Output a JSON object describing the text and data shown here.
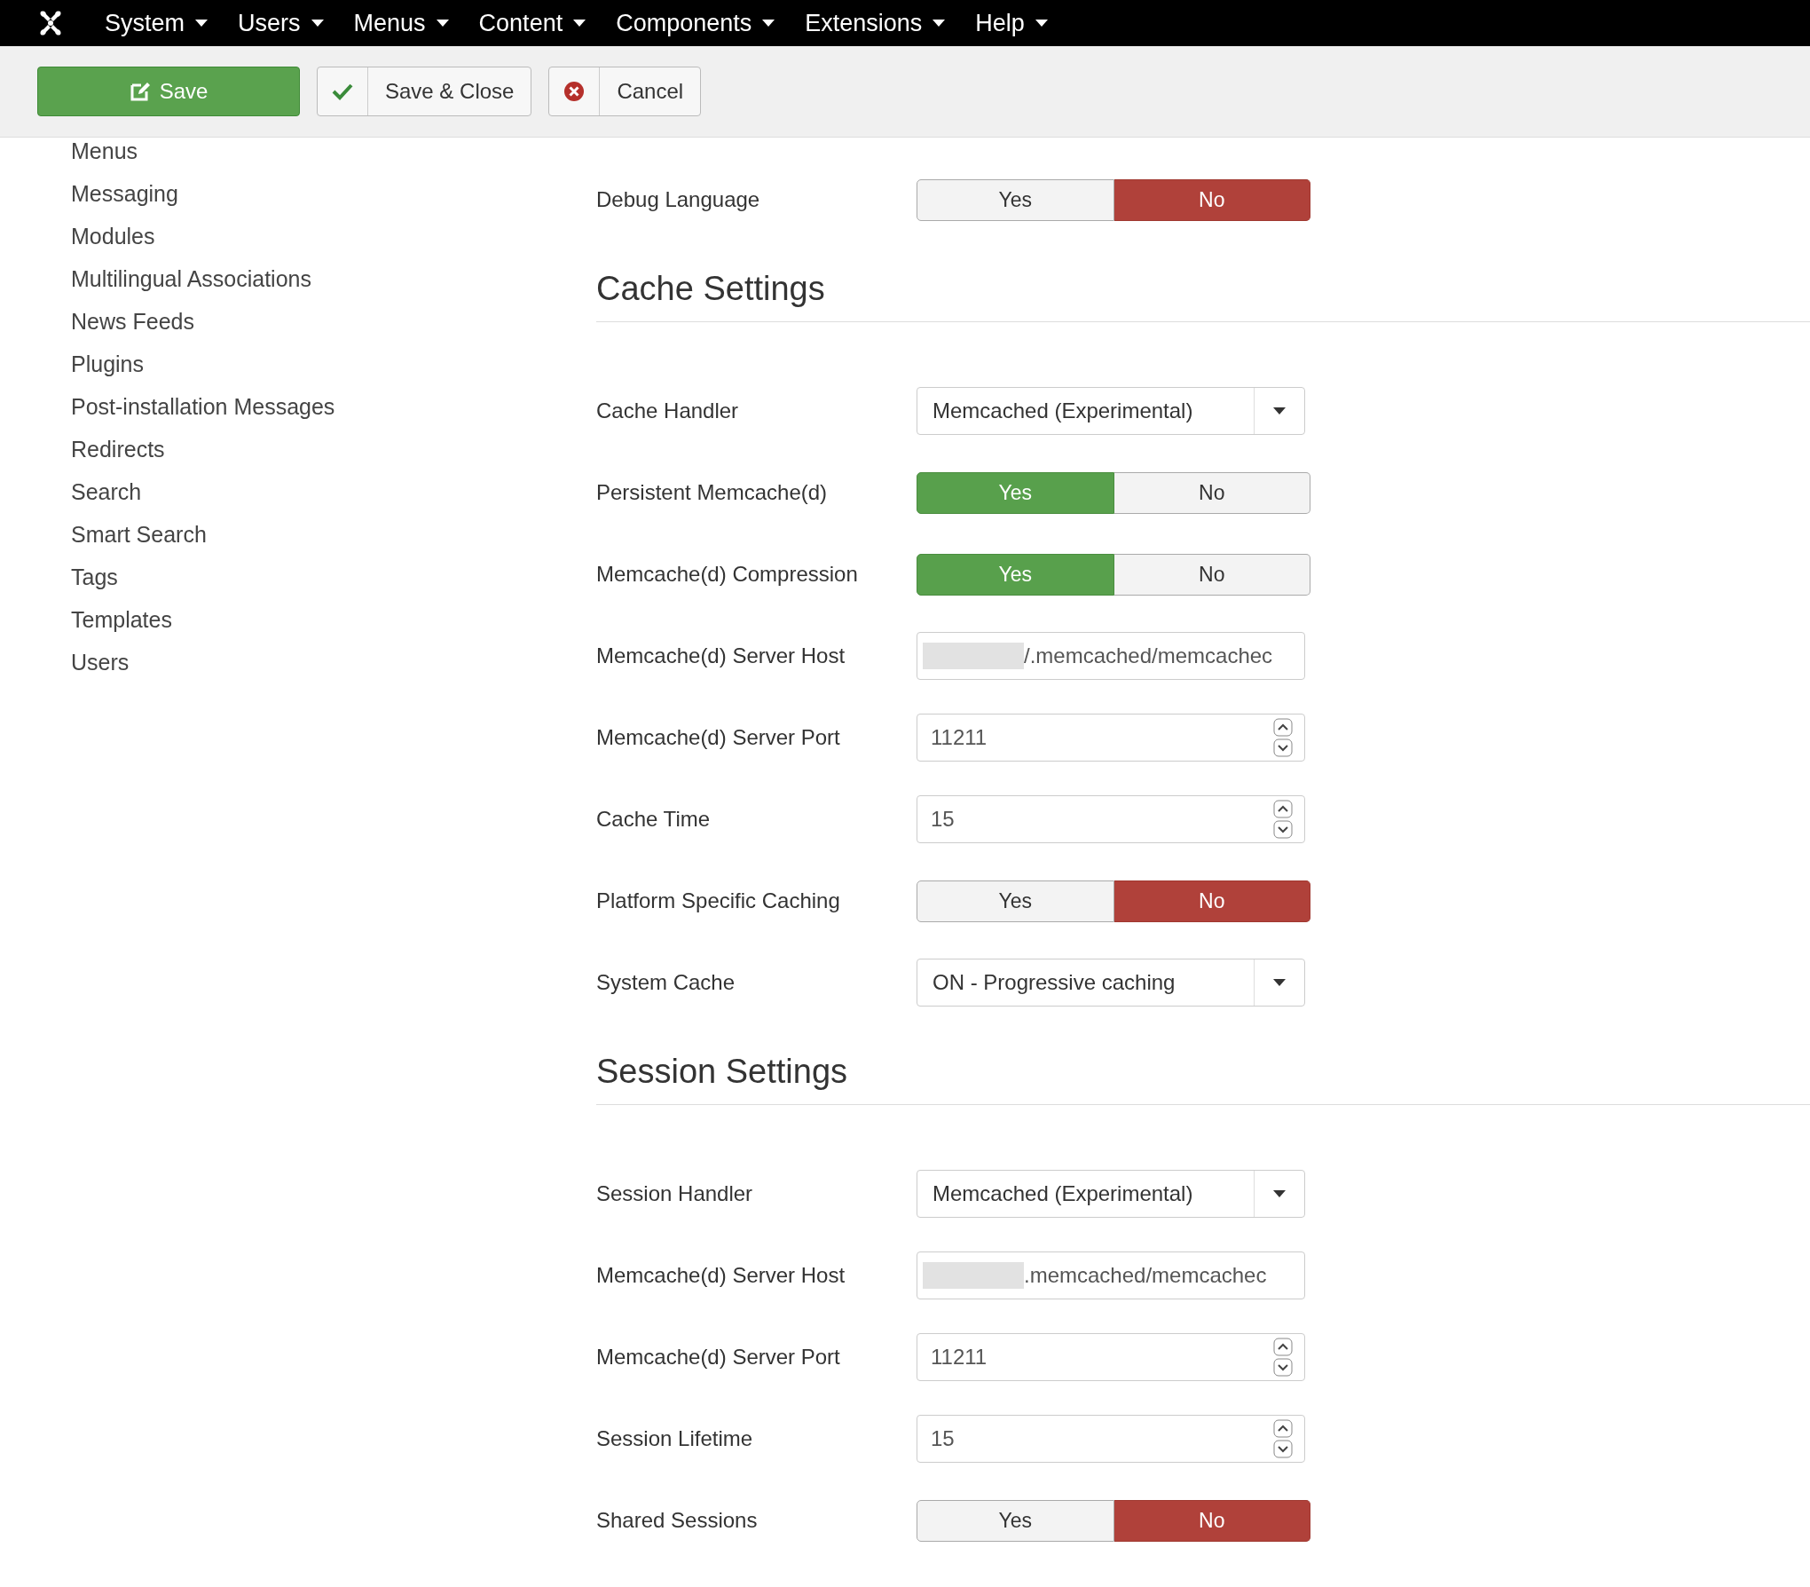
{
  "navbar": {
    "menus": [
      {
        "label": "System"
      },
      {
        "label": "Users"
      },
      {
        "label": "Menus"
      },
      {
        "label": "Content"
      },
      {
        "label": "Components"
      },
      {
        "label": "Extensions"
      },
      {
        "label": "Help"
      }
    ]
  },
  "toolbar": {
    "buttons": [
      {
        "kind": "save",
        "label": "Save"
      },
      {
        "kind": "check",
        "label": "Save & Close"
      },
      {
        "kind": "cancel",
        "label": "Cancel"
      }
    ]
  },
  "sidebar": {
    "items": [
      "Menus",
      "Messaging",
      "Modules",
      "Multilingual Associations",
      "News Feeds",
      "Plugins",
      "Post-installation Messages",
      "Redirects",
      "Search",
      "Smart Search",
      "Tags",
      "Templates",
      "Users"
    ]
  },
  "sections": [
    {
      "fields": [
        {
          "kind": "toggle",
          "label": "Debug Language",
          "options": [
            {
              "label": "Yes",
              "selected": false
            },
            {
              "label": "No",
              "selected": true
            }
          ]
        }
      ]
    },
    {
      "heading": "Cache Settings",
      "fields": [
        {
          "kind": "select",
          "label": "Cache Handler",
          "value": "Memcached (Experimental)"
        },
        {
          "kind": "toggle",
          "label": "Persistent Memcache(d)",
          "options": [
            {
              "label": "Yes",
              "selected": true
            },
            {
              "label": "No",
              "selected": false
            }
          ]
        },
        {
          "kind": "toggle",
          "label": "Memcache(d) Compression",
          "options": [
            {
              "label": "Yes",
              "selected": true
            },
            {
              "label": "No",
              "selected": false
            }
          ]
        },
        {
          "kind": "text",
          "label": "Memcache(d) Server Host",
          "value": "/.memcached/memcachec",
          "redacted": true
        },
        {
          "kind": "number",
          "label": "Memcache(d) Server Port",
          "value": "11211"
        },
        {
          "kind": "number",
          "label": "Cache Time",
          "value": "15"
        },
        {
          "kind": "toggle",
          "label": "Platform Specific Caching",
          "options": [
            {
              "label": "Yes",
              "selected": false
            },
            {
              "label": "No",
              "selected": true
            }
          ]
        },
        {
          "kind": "select",
          "label": "System Cache",
          "value": "ON - Progressive caching"
        }
      ]
    },
    {
      "heading": "Session Settings",
      "fields": [
        {
          "kind": "select",
          "label": "Session Handler",
          "value": "Memcached (Experimental)"
        },
        {
          "kind": "text",
          "label": "Memcache(d) Server Host",
          "value": ".memcached/memcachec",
          "redacted": true
        },
        {
          "kind": "number",
          "label": "Memcache(d) Server Port",
          "value": "11211"
        },
        {
          "kind": "number",
          "label": "Session Lifetime",
          "value": "15"
        },
        {
          "kind": "toggle",
          "label": "Shared Sessions",
          "options": [
            {
              "label": "Yes",
              "selected": false
            },
            {
              "label": "No",
              "selected": true
            }
          ]
        }
      ]
    }
  ]
}
